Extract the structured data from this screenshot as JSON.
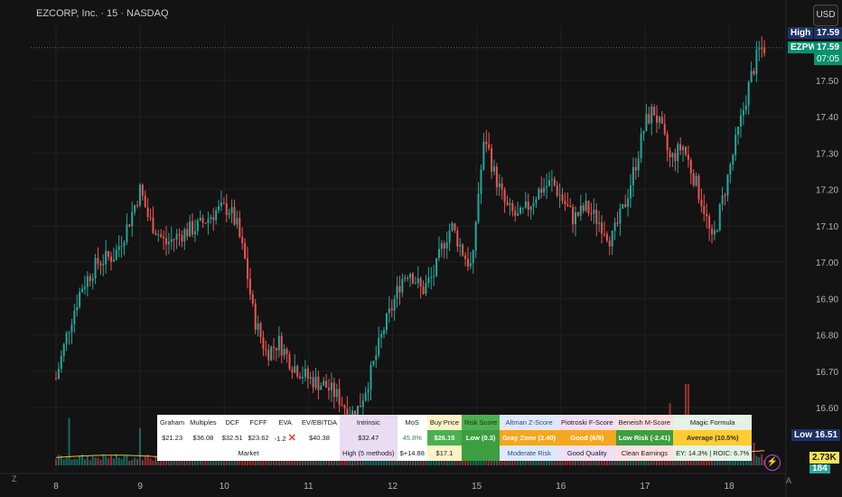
{
  "header": {
    "title": "EZCORP, Inc. · 15 · NASDAQ",
    "currency": "USD"
  },
  "price_tags": {
    "high_label": "High",
    "high_value": "17.59",
    "symbol": "EZPW",
    "last_value": "17.59",
    "countdown": "07:05",
    "low_label": "Low",
    "low_value": "16.51",
    "volume_value": "2.73K",
    "volume_value2": "184"
  },
  "colors": {
    "up": "#26a69a",
    "down": "#ef5350",
    "volume_up": "#1e7d74",
    "volume_down": "#b53a38",
    "average_line": "#f0c330",
    "grid": "#202020"
  },
  "chart_data": {
    "type": "candlestick",
    "title": "EZCORP, Inc. · 15 · NASDAQ",
    "x_tick_labels": [
      "8",
      "9",
      "10",
      "11",
      "12",
      "15",
      "16",
      "17",
      "18"
    ],
    "y_tick_labels": [
      "16.60",
      "16.70",
      "16.80",
      "16.90",
      "17.00",
      "17.10",
      "17.20",
      "17.30",
      "17.40",
      "17.50"
    ],
    "ylim": [
      16.5,
      17.65
    ],
    "grid": true,
    "high": 17.59,
    "low": 16.51,
    "last": 17.59,
    "close_path": [
      [
        0,
        16.68
      ],
      [
        0.15,
        16.82
      ],
      [
        0.3,
        16.93
      ],
      [
        0.5,
        17.0
      ],
      [
        0.7,
        17.02
      ],
      [
        0.85,
        17.1
      ],
      [
        1.0,
        17.2
      ],
      [
        1.1,
        17.12
      ],
      [
        1.3,
        17.05
      ],
      [
        1.5,
        17.08
      ],
      [
        1.7,
        17.1
      ],
      [
        1.9,
        17.14
      ],
      [
        2.05,
        17.15
      ],
      [
        2.15,
        17.1
      ],
      [
        2.25,
        17.0
      ],
      [
        2.35,
        16.85
      ],
      [
        2.5,
        16.75
      ],
      [
        2.65,
        16.78
      ],
      [
        2.8,
        16.72
      ],
      [
        3.0,
        16.68
      ],
      [
        3.2,
        16.66
      ],
      [
        3.35,
        16.63
      ],
      [
        3.5,
        16.58
      ],
      [
        3.6,
        16.6
      ],
      [
        3.75,
        16.7
      ],
      [
        3.9,
        16.82
      ],
      [
        4.0,
        16.88
      ],
      [
        4.1,
        16.95
      ],
      [
        4.2,
        16.98
      ],
      [
        4.35,
        16.92
      ],
      [
        4.5,
        16.97
      ],
      [
        4.6,
        17.05
      ],
      [
        4.7,
        17.1
      ],
      [
        4.85,
        17.02
      ],
      [
        4.95,
        16.98
      ],
      [
        5.0,
        17.15
      ],
      [
        5.1,
        17.35
      ],
      [
        5.2,
        17.25
      ],
      [
        5.35,
        17.15
      ],
      [
        5.5,
        17.12
      ],
      [
        5.6,
        17.15
      ],
      [
        5.75,
        17.2
      ],
      [
        5.9,
        17.22
      ],
      [
        6.0,
        17.18
      ],
      [
        6.15,
        17.12
      ],
      [
        6.3,
        17.15
      ],
      [
        6.5,
        17.1
      ],
      [
        6.6,
        17.06
      ],
      [
        6.75,
        17.15
      ],
      [
        6.9,
        17.28
      ],
      [
        7.0,
        17.38
      ],
      [
        7.1,
        17.42
      ],
      [
        7.2,
        17.36
      ],
      [
        7.3,
        17.28
      ],
      [
        7.45,
        17.32
      ],
      [
        7.6,
        17.22
      ],
      [
        7.7,
        17.15
      ],
      [
        7.8,
        17.05
      ],
      [
        7.85,
        17.1
      ],
      [
        7.95,
        17.2
      ],
      [
        8.05,
        17.3
      ],
      [
        8.15,
        17.4
      ],
      [
        8.25,
        17.5
      ],
      [
        8.35,
        17.58
      ],
      [
        8.42,
        17.59
      ]
    ],
    "volume_spikes": [
      {
        "x": 0.15,
        "v": 0.42
      },
      {
        "x": 1.0,
        "v": 0.33
      },
      {
        "x": 2.3,
        "v": 0.25
      },
      {
        "x": 2.9,
        "v": 0.3
      },
      {
        "x": 3.3,
        "v": 0.34
      },
      {
        "x": 3.55,
        "v": 0.38
      },
      {
        "x": 5.1,
        "v": 0.45
      },
      {
        "x": 6.5,
        "v": 0.28
      },
      {
        "x": 7.3,
        "v": 0.55
      },
      {
        "x": 7.5,
        "v": 0.72
      },
      {
        "x": 7.9,
        "v": 0.25
      },
      {
        "x": 8.3,
        "v": 0.2
      }
    ]
  },
  "fundamentals": {
    "headers": [
      "Graham",
      "Multiples",
      "DCF",
      "FCFF",
      "EVA",
      "EV/EBITDA",
      "Intrinsic",
      "MoS",
      "Buy Price",
      "Risk Score",
      "Altman Z-Score",
      "Piotroski F-Score",
      "Beneish M-Score",
      "Magic Formula"
    ],
    "values": [
      "$21.23",
      "$36.08",
      "$32.51",
      "$23.62",
      "-1.2",
      "✕",
      "$40.38",
      "$32.47",
      "45.8%",
      "$26.15",
      "Low (0.3)",
      "Gray Zone (2.40)",
      "Good (6/9)",
      "Low Risk (-2.41)",
      "Average (10.5%)"
    ],
    "row3": {
      "market": "Market",
      "intrinsic": "High (5 methods)",
      "mos": "$+14.88",
      "buy": "$17.1",
      "risk": "",
      "altman": "Moderate Risk",
      "piotroski": "Good Quality",
      "beneish": "Clean Earnings",
      "magic": "EY: 14.3% | ROIC: 6.7%"
    }
  }
}
